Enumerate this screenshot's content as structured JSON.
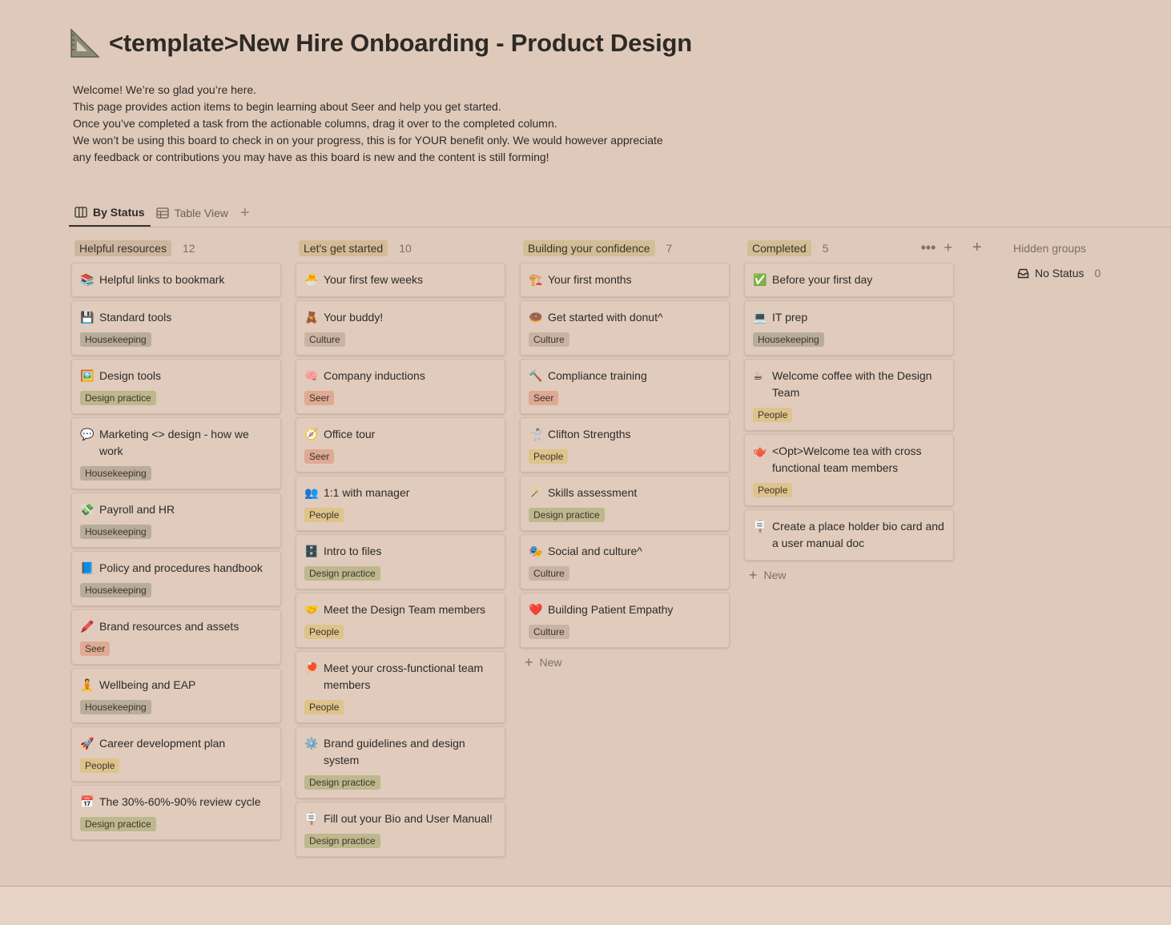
{
  "page": {
    "icon": "triangle-ruler-icon",
    "title": "<template>New Hire Onboarding - Product Design",
    "description": [
      "Welcome! We’re so glad you’re here.",
      "This page provides action items to begin learning about Seer and help you get started.",
      "Once you’ve completed a task from the actionable columns, drag it over to the completed column.",
      "We won’t be using this board to check in on your progress, this is for YOUR benefit only. We would however appreciate",
      "any feedback or contributions you may have as this board is new and the content is still forming!"
    ]
  },
  "views": [
    {
      "label": "By Status",
      "icon": "board-icon",
      "active": true
    },
    {
      "label": "Table View",
      "icon": "table-icon",
      "active": false
    }
  ],
  "add_view_label": "+",
  "columns": [
    {
      "label": "Helpful resources",
      "count": "12",
      "cards": [
        {
          "emoji": "📚",
          "title": "Helpful links to bookmark",
          "tag": ""
        },
        {
          "emoji": "💾",
          "title": "Standard tools",
          "tag": "Housekeeping"
        },
        {
          "emoji": "🖼️",
          "title": "Design tools",
          "tag": "Design practice"
        },
        {
          "emoji": "💬",
          "title": "Marketing <> design - how we work",
          "tag": "Housekeeping"
        },
        {
          "emoji": "💸",
          "title": "Payroll and HR",
          "tag": "Housekeeping"
        },
        {
          "emoji": "📘",
          "title": "Policy and procedures handbook",
          "tag": "Housekeeping"
        },
        {
          "emoji": "🖍️",
          "title": "Brand resources and assets",
          "tag": "Seer"
        },
        {
          "emoji": "🧘",
          "title": "Wellbeing and EAP",
          "tag": "Housekeeping"
        },
        {
          "emoji": "🚀",
          "title": "Career development plan",
          "tag": "People"
        },
        {
          "emoji": "📅",
          "title": "The 30%-60%-90% review cycle",
          "tag": "Design practice"
        }
      ]
    },
    {
      "label": "Let's get started",
      "count": "10",
      "cards": [
        {
          "emoji": "🐣",
          "title": "Your first few weeks",
          "tag": ""
        },
        {
          "emoji": "🧸",
          "title": "Your buddy!",
          "tag": "Culture"
        },
        {
          "emoji": "🧠",
          "title": "Company inductions",
          "tag": "Seer"
        },
        {
          "emoji": "🧭",
          "title": "Office tour",
          "tag": "Seer"
        },
        {
          "emoji": "👥",
          "title": "1:1 with manager",
          "tag": "People"
        },
        {
          "emoji": "🗄️",
          "title": "Intro to files",
          "tag": "Design practice"
        },
        {
          "emoji": "🤝",
          "title": "Meet the Design Team members",
          "tag": "People"
        },
        {
          "emoji": "🏓",
          "title": "Meet your cross-functional team members",
          "tag": "People"
        },
        {
          "emoji": "⚙️",
          "title": "Brand guidelines and design system",
          "tag": "Design practice"
        },
        {
          "emoji": "🪧",
          "title": "Fill out your Bio and User Manual!",
          "tag": "Design practice"
        }
      ]
    },
    {
      "label": "Building your confidence",
      "count": "7",
      "cards": [
        {
          "emoji": "🏗️",
          "title": "Your first months",
          "tag": ""
        },
        {
          "emoji": "🍩",
          "title": "Get started with donut^",
          "tag": "Culture"
        },
        {
          "emoji": "🔨",
          "title": "Compliance training",
          "tag": "Seer"
        },
        {
          "emoji": "🤺",
          "title": "Clifton Strengths",
          "tag": "People"
        },
        {
          "emoji": "🪄",
          "title": "Skills assessment",
          "tag": "Design practice"
        },
        {
          "emoji": "🎭",
          "title": "Social and culture^",
          "tag": "Culture"
        },
        {
          "emoji": "❤️",
          "title": "Building Patient Empathy",
          "tag": "Culture"
        }
      ],
      "new_label": "New"
    },
    {
      "label": "Completed",
      "count": "5",
      "cards": [
        {
          "emoji": "✅",
          "title": "Before your first day",
          "tag": ""
        },
        {
          "emoji": "💻",
          "title": "IT prep",
          "tag": "Housekeeping"
        },
        {
          "emoji": "☕",
          "title": "Welcome coffee with the Design Team",
          "tag": "People"
        },
        {
          "emoji": "🫖",
          "title": "<Opt>Welcome tea with cross functional team members",
          "tag": "People"
        },
        {
          "emoji": "🪧",
          "title": "Create a place holder bio card and a user manual doc",
          "tag": ""
        }
      ],
      "new_label": "New"
    }
  ],
  "hidden_groups": {
    "label": "Hidden groups",
    "items": [
      {
        "icon": "inbox-icon",
        "label": "No Status",
        "count": "0"
      }
    ]
  },
  "colors": {
    "background": "#dfc9bb",
    "card": "#e0cbbd",
    "tag_housekeeping": "#b9ad99",
    "tag_design_practice": "#bdb88d",
    "tag_culture": "#c9b3a3",
    "tag_seer": "#dfa994",
    "tag_people": "#dec38b"
  }
}
